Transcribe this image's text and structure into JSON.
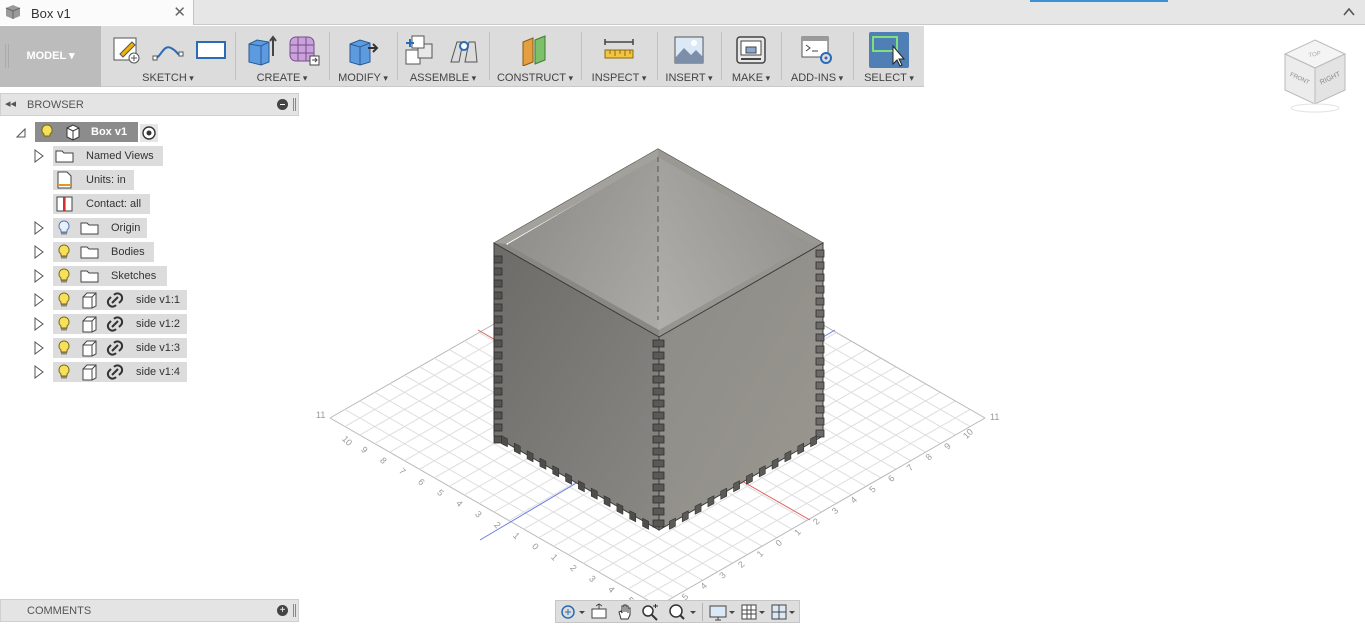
{
  "document": {
    "tab_title": "Box v1",
    "close_glyph": "✕",
    "collapse_icon": "chevron-up-icon"
  },
  "toolbar": {
    "workspace": "MODEL ▾",
    "groups": [
      {
        "label": "SKETCH",
        "icons": [
          "create-sketch-icon",
          "spline-icon",
          "rectangle-icon"
        ]
      },
      {
        "label": "CREATE",
        "icons": [
          "extrude-icon",
          "form-icon"
        ]
      },
      {
        "label": "MODIFY",
        "icons": [
          "press-pull-icon"
        ]
      },
      {
        "label": "ASSEMBLE",
        "icons": [
          "new-component-icon",
          "joint-icon"
        ]
      },
      {
        "label": "CONSTRUCT",
        "icons": [
          "offset-plane-icon"
        ]
      },
      {
        "label": "INSPECT",
        "icons": [
          "measure-icon"
        ]
      },
      {
        "label": "INSERT",
        "icons": [
          "insert-image-icon"
        ]
      },
      {
        "label": "MAKE",
        "icons": [
          "3d-print-icon"
        ]
      },
      {
        "label": "ADD-INS",
        "icons": [
          "scripts-icon"
        ]
      },
      {
        "label": "SELECT",
        "icons": [
          "select-icon"
        ]
      }
    ]
  },
  "viewcube": {
    "top": "TOP",
    "front": "FRONT",
    "right": "RIGHT"
  },
  "browser": {
    "title": "BROWSER",
    "collapse_glyph": "◂◂",
    "root": {
      "label": "Box v1"
    },
    "items": [
      {
        "label": "Named Views",
        "type": "folder",
        "expandable": true,
        "bulb": false
      },
      {
        "label": "Units: in",
        "type": "units",
        "expandable": false,
        "bulb": false
      },
      {
        "label": "Contact: all",
        "type": "contact",
        "expandable": false,
        "bulb": false
      },
      {
        "label": "Origin",
        "type": "folder",
        "expandable": true,
        "bulb": true,
        "bulb_on": false
      },
      {
        "label": "Bodies",
        "type": "folder",
        "expandable": true,
        "bulb": true,
        "bulb_on": true
      },
      {
        "label": "Sketches",
        "type": "folder",
        "expandable": true,
        "bulb": true,
        "bulb_on": true
      },
      {
        "label": "side v1:1",
        "type": "component-link",
        "expandable": true,
        "bulb": true,
        "bulb_on": true
      },
      {
        "label": "side v1:2",
        "type": "component-link",
        "expandable": true,
        "bulb": true,
        "bulb_on": true
      },
      {
        "label": "side v1:3",
        "type": "component-link",
        "expandable": true,
        "bulb": true,
        "bulb_on": true
      },
      {
        "label": "side v1:4",
        "type": "component-link",
        "expandable": true,
        "bulb": true,
        "bulb_on": true
      }
    ]
  },
  "comments": {
    "title": "COMMENTS",
    "add_glyph": "+"
  },
  "grid": {
    "left_axis_labels": [
      "10",
      "9",
      "8",
      "7",
      "6",
      "5",
      "4",
      "3",
      "2",
      "1",
      "0",
      "1",
      "2",
      "3",
      "4",
      "5"
    ],
    "right_axis_labels": [
      "10",
      "9",
      "8",
      "7",
      "6",
      "5",
      "4",
      "3",
      "2",
      "1",
      "0",
      "1",
      "2",
      "3",
      "4",
      "5"
    ],
    "end_labels": [
      "11",
      "11"
    ]
  },
  "navbar": {
    "icons": [
      "orbit-icon",
      "look-at-icon",
      "pan-icon",
      "zoom-icon",
      "fit-icon",
      "display-settings-icon",
      "grid-settings-icon",
      "viewports-icon"
    ]
  },
  "colors": {
    "toolbar_bg": "#dcdcdc",
    "workspace_bg": "#bcbcbc",
    "select_active": "#4f7fb4",
    "pill_bg": "#dcdcdc",
    "root_pill_bg": "#8c8c8c",
    "box_light": "#8f8d89",
    "box_dark": "#6e6c68",
    "axis_red": "#e06060",
    "axis_blue": "#6c7ee0",
    "grid_line": "#d6d6d6"
  }
}
